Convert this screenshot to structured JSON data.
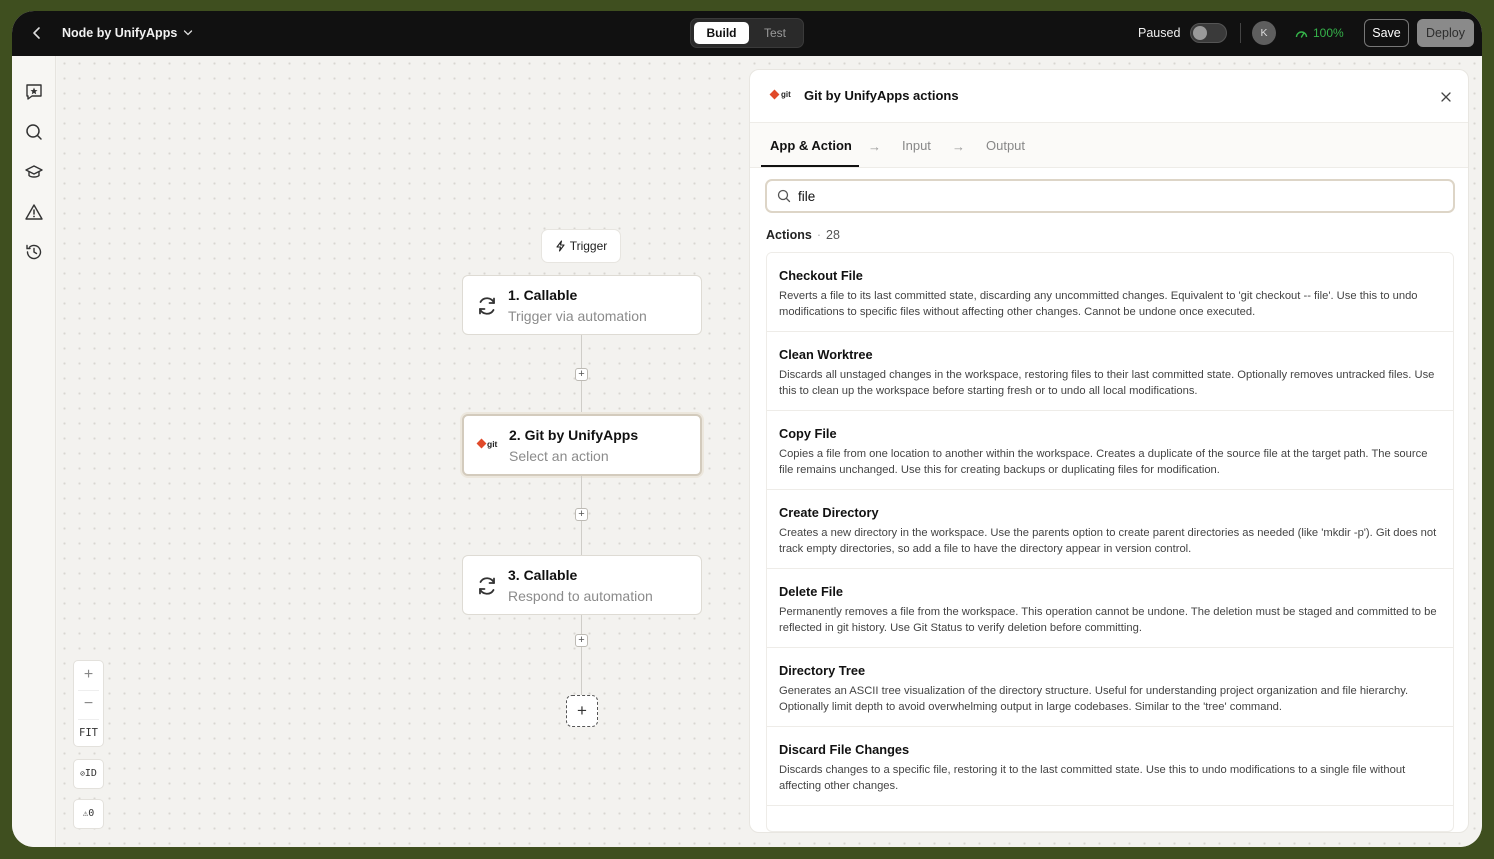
{
  "topbar": {
    "back_icon": "chevron-left-icon",
    "app_title": "Node by UnifyApps",
    "modes": {
      "build": "Build",
      "test": "Test"
    },
    "paused_label": "Paused",
    "paused_toggle_on": false,
    "avatar_initial": "K",
    "health_percent": "100%",
    "save_label": "Save",
    "deploy_label": "Deploy",
    "colors": {
      "health": "#35b34a",
      "bar": "#111111"
    }
  },
  "rail": {
    "icons": [
      "chat-star-icon",
      "search-icon",
      "graduation-cap-icon",
      "warning-icon",
      "history-icon"
    ]
  },
  "canvas": {
    "trigger_label": "Trigger",
    "nodes": [
      {
        "title": "1. Callable",
        "subtitle": "Trigger via automation",
        "icon": "refresh-icon"
      },
      {
        "title": "2. Git by UnifyApps",
        "subtitle": "Select an action",
        "icon": "git-logo-icon"
      },
      {
        "title": "3. Callable",
        "subtitle": "Respond to automation",
        "icon": "refresh-icon"
      }
    ],
    "zoom": {
      "in": "+",
      "out": "−",
      "fit": "FIT"
    },
    "id_toggle": "ID",
    "warning_count": "0"
  },
  "panel": {
    "logo_text": "git",
    "title": "Git by UnifyApps actions",
    "tabs": [
      {
        "label": "App & Action",
        "active": true
      },
      {
        "label": "Input",
        "active": false
      },
      {
        "label": "Output",
        "active": false
      }
    ],
    "search": {
      "value": "file",
      "placeholder": ""
    },
    "actions_label": "Actions",
    "actions_count": "28",
    "actions": [
      {
        "title": "Checkout File",
        "description": "Reverts a file to its last committed state, discarding any uncommitted changes. Equivalent to 'git checkout -- file'. Use this to undo modifications to specific files without affecting other changes. Cannot be undone once executed."
      },
      {
        "title": "Clean Worktree",
        "description": "Discards all unstaged changes in the workspace, restoring files to their last committed state. Optionally removes untracked files. Use this to clean up the workspace before starting fresh or to undo all local modifications."
      },
      {
        "title": "Copy File",
        "description": "Copies a file from one location to another within the workspace. Creates a duplicate of the source file at the target path. The source file remains unchanged. Use this for creating backups or duplicating files for modification."
      },
      {
        "title": "Create Directory",
        "description": "Creates a new directory in the workspace. Use the parents option to create parent directories as needed (like 'mkdir -p'). Git does not track empty directories, so add a file to have the directory appear in version control."
      },
      {
        "title": "Delete File",
        "description": "Permanently removes a file from the workspace. This operation cannot be undone. The deletion must be staged and committed to be reflected in git history. Use Git Status to verify deletion before committing."
      },
      {
        "title": "Directory Tree",
        "description": "Generates an ASCII tree visualization of the directory structure. Useful for understanding project organization and file hierarchy. Optionally limit depth to avoid overwhelming output in large codebases. Similar to the 'tree' command."
      },
      {
        "title": "Discard File Changes",
        "description": "Discards changes to a specific file, restoring it to the last committed state. Use this to undo modifications to a single file without affecting other changes."
      }
    ]
  }
}
